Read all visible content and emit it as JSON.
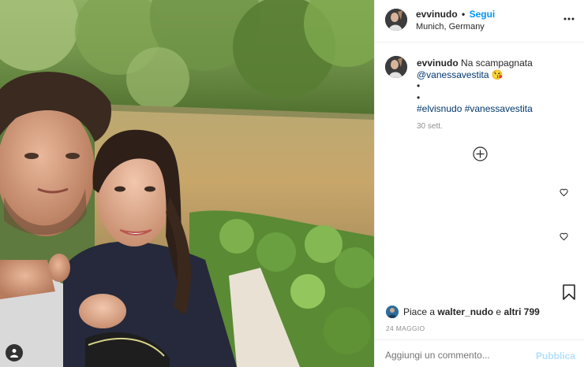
{
  "post": {
    "username": "evvinudo",
    "separator": "•",
    "follow_label": "Segui",
    "location": "Munich, Germany",
    "more_icon": "more-horizontal-icon"
  },
  "caption": {
    "username": "evvinudo",
    "text": "Na scampagnata",
    "mention": "@vanessavestita",
    "emoji": "😘",
    "bullets": [
      "•",
      "•"
    ],
    "hashtags": "#elvisnudo #vanessavestita",
    "time": "30 sett."
  },
  "likes": {
    "prefix": "Piace a",
    "user": "walter_nudo",
    "connector": "e",
    "others": "altri 799"
  },
  "date": "24 MAGGIO",
  "comment": {
    "placeholder": "Aggiungi un commento...",
    "publish_label": "Pubblica"
  },
  "colors": {
    "link": "#00376b",
    "follow": "#0095f6",
    "publish_disabled": "#b2dffc",
    "muted": "#8e8e8e"
  }
}
